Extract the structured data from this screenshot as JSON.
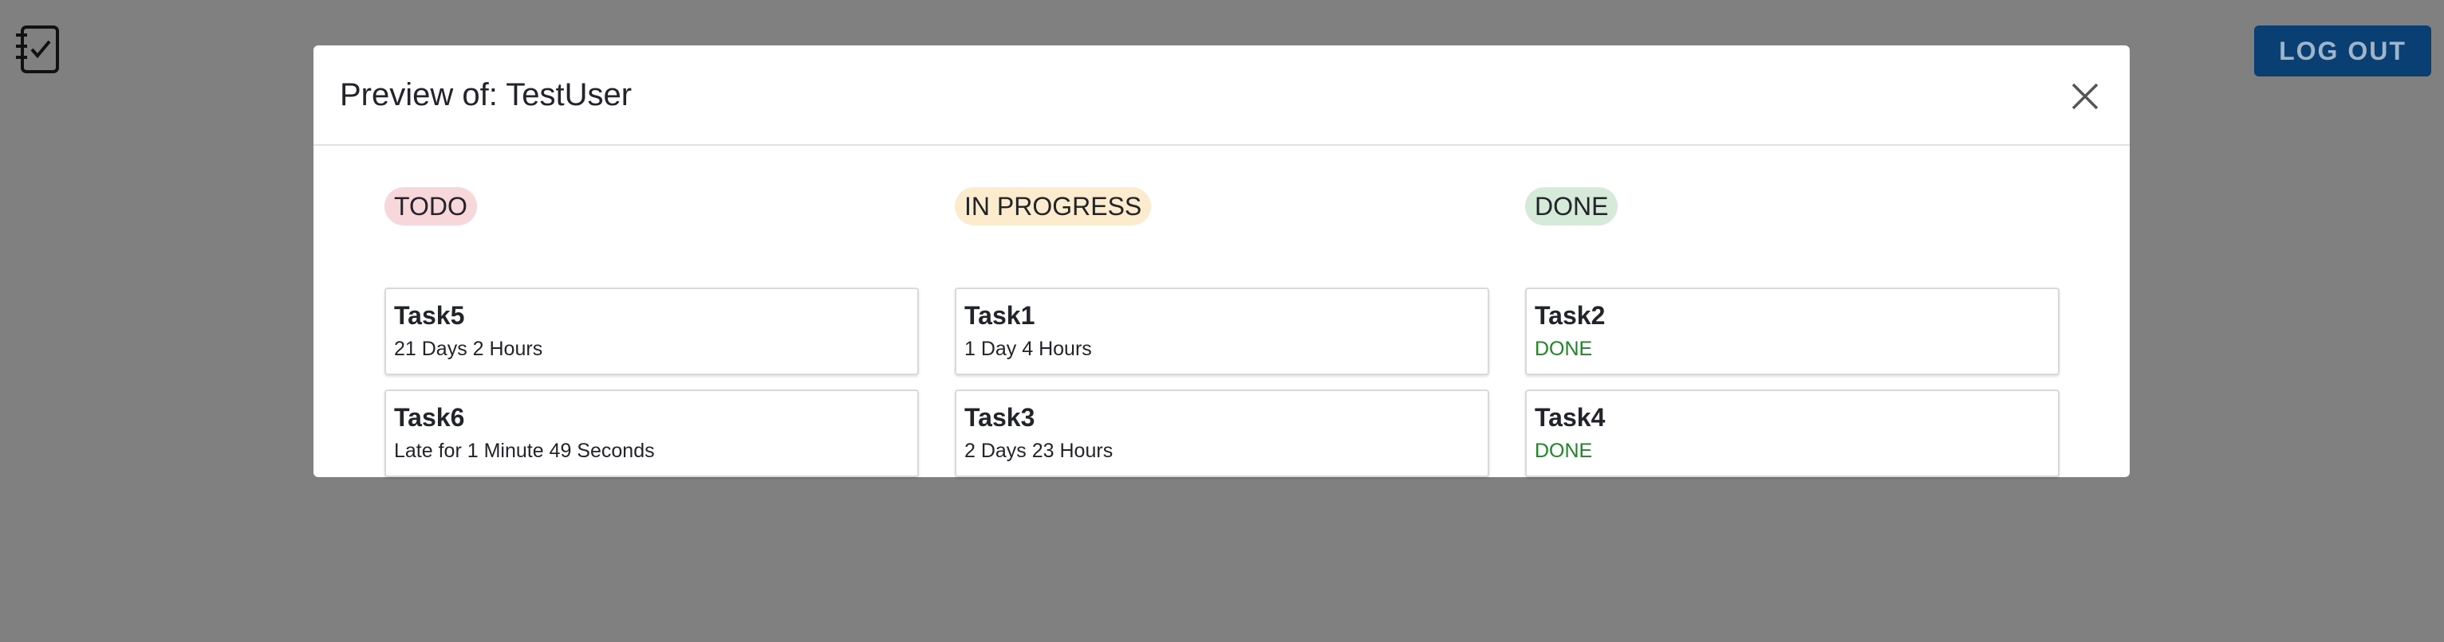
{
  "header": {
    "logout_label": "LOG OUT"
  },
  "modal": {
    "title": "Preview of: TestUser",
    "columns": [
      {
        "label": "TODO",
        "tasks": [
          {
            "name": "Task5",
            "status": "21 Days 2 Hours"
          },
          {
            "name": "Task6",
            "status": "Late for 1 Minute 49 Seconds"
          }
        ]
      },
      {
        "label": "IN PROGRESS",
        "tasks": [
          {
            "name": "Task1",
            "status": "1 Day 4 Hours"
          },
          {
            "name": "Task3",
            "status": "2 Days 23 Hours"
          }
        ]
      },
      {
        "label": "DONE",
        "tasks": [
          {
            "name": "Task2",
            "status": "DONE"
          },
          {
            "name": "Task4",
            "status": "DONE"
          }
        ]
      }
    ]
  },
  "icons": {
    "app_logo": "checklist-icon",
    "close": "close-icon"
  },
  "colors": {
    "overlay": "#808080",
    "logout_bg": "#0a3f73",
    "todo_badge": "#f8d7da",
    "progress_badge": "#fcebcd",
    "done_badge": "#d6ead9",
    "done_text": "#198a1f"
  }
}
